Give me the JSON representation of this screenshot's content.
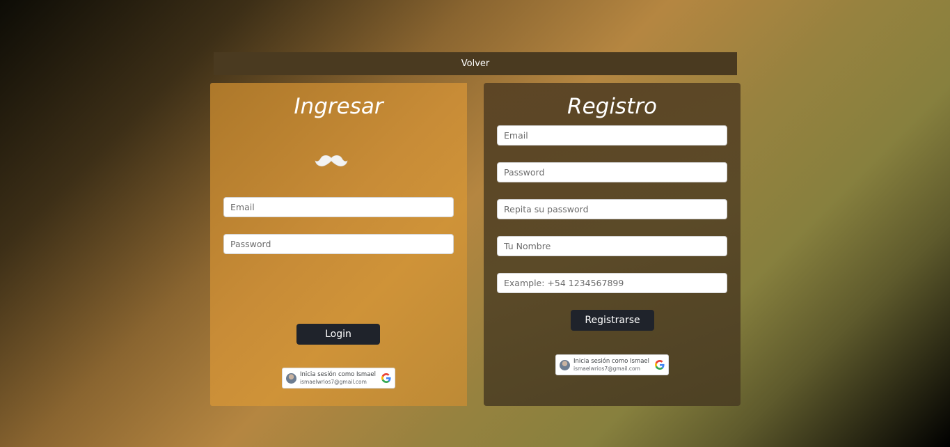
{
  "nav": {
    "back_label": "Volver"
  },
  "login": {
    "title": "Ingresar",
    "email_placeholder": "Email",
    "password_placeholder": "Password",
    "submit_label": "Login",
    "google": {
      "name_line": "Inicia sesión como Ismael",
      "email_line": "ismaelwrios7@gmail.com"
    }
  },
  "register": {
    "title": "Registro",
    "email_placeholder": "Email",
    "password_placeholder": "Password",
    "repeat_password_placeholder": "Repita su password",
    "name_placeholder": "Tu Nombre",
    "phone_placeholder": "Example: +54 1234567899",
    "submit_label": "Registrarse",
    "google": {
      "name_line": "Inicia sesión como Ismael",
      "email_line": "ismaelwrios7@gmail.com"
    }
  },
  "icons": {
    "logo": "mustache-icon",
    "google": "google-g-icon",
    "avatar": "user-avatar"
  },
  "colors": {
    "login_panel": "#c88c37",
    "register_panel": "#5b4a28",
    "button": "#1f232b",
    "back_bar": "#4a3a20"
  }
}
